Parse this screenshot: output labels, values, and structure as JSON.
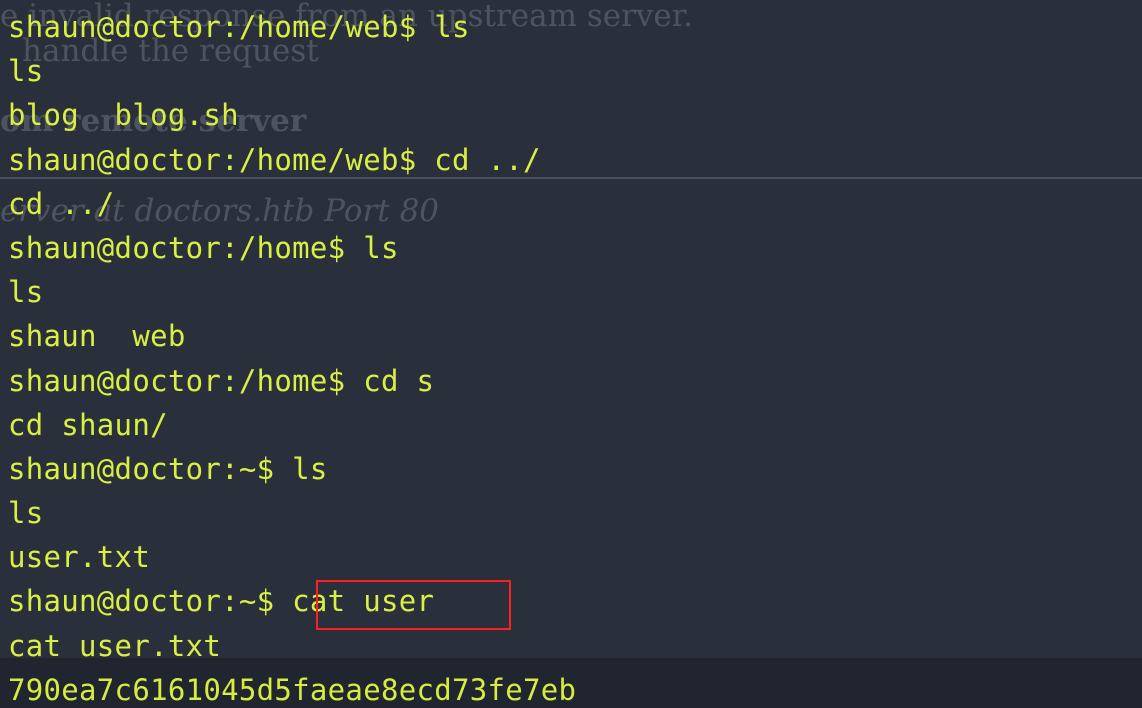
{
  "background_text": [
    "e invalid response from an upstream server.",
    "handle the request",
    "om remote server",
    "erver at doctors.htb Port 80"
  ],
  "terminal": {
    "lines": [
      "shaun@doctor:/home/web$ ls",
      "ls",
      "blog  blog.sh",
      "shaun@doctor:/home/web$ cd ../",
      "cd ../",
      "shaun@doctor:/home$ ls",
      "ls",
      "shaun  web",
      "shaun@doctor:/home$ cd s",
      "cd shaun/",
      "shaun@doctor:~$ ls",
      "ls",
      "user.txt",
      "shaun@doctor:~$ cat user",
      "cat user.txt",
      "790ea7c6161045d5faeae8ecd73fe7eb"
    ],
    "highlight_text": "cat user"
  },
  "colors": {
    "terminal_background": "#2a303b",
    "terminal_text": "#d9ef44",
    "highlight_border": "#ff1f1f",
    "bottom_band": "#20252f"
  }
}
